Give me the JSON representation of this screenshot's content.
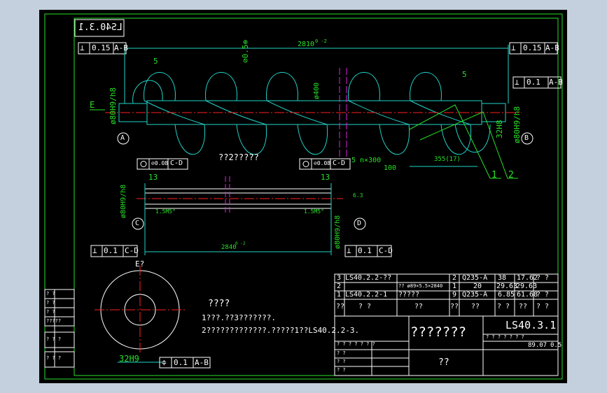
{
  "colors": {
    "background": "#000000",
    "outer_frame": "#c5d0de",
    "green": "#28e128",
    "white": "#ffffff",
    "cyan": "#22d3c9",
    "red": "#ff2020",
    "magenta": "#e020e0",
    "yellow": "#f0f040"
  },
  "drawing": {
    "mirrored_code": "LS40.3.1",
    "fcf_top_left": {
      "symbol": "⊥",
      "tol": "0.15",
      "datum": "A-B"
    },
    "fcf_top_right": {
      "symbol": "⊥",
      "tol": "0.15",
      "datum": "A-B"
    },
    "fcf_right_1": {
      "symbol": "⊥",
      "tol": "0.1",
      "datum": "A-B"
    },
    "fcf_right_2": {
      "symbol": "⊥",
      "tol": "0.1",
      "datum": "A-B"
    },
    "dim_total": "2810",
    "dim_total_tol": "0 -2",
    "dim_pitch_note": "⊘0.5⊕",
    "dim_dia_400": "ø400",
    "dim_fit_left": "ø80H9/h8",
    "dim_fit_right": "ø80H9/h8",
    "dim_32h8": "32H8",
    "weld_5": "5",
    "weld_note": "5 n×300",
    "weld_angle": "100",
    "dim_355": "355(17)",
    "leader_1": "1",
    "leader_2": "2",
    "datum_A": "A",
    "datum_B": "B",
    "datum_C": "C",
    "datum_D": "D",
    "section_E": "E",
    "view_title_shaft": "??2?????",
    "fcf_c1": {
      "tol": "⊘0.08",
      "datum": "C-D"
    },
    "fcf_c2": {
      "tol": "⊘0.08",
      "datum": "C-D"
    },
    "dim_13_left": "13",
    "dim_13_right": "13",
    "chamfer_left": "1.5M5°",
    "chamfer_right": "1.5M5°",
    "roughness": "6.3",
    "dim_fit_c": "ø80H9/h8",
    "dim_fit_d": "ø80H9/h8",
    "dim_shaft_len": "2840",
    "dim_shaft_tol": "0 -2",
    "fcf_bottom_left": {
      "symbol": "⊥",
      "tol": "0.1",
      "datum": "C-D"
    },
    "fcf_bottom_right": {
      "symbol": "⊥",
      "tol": "0.1",
      "datum": "C-D"
    },
    "section_view_label": "E?",
    "dim_32h9": "32H9",
    "fcf_section": {
      "symbol": "≑",
      "tol": "0.1",
      "datum": "A-B"
    },
    "notes_title": "????",
    "note_1": "1???.??3???????.",
    "note_2": "2?????????????.?????1??LS40.2.2-3.",
    "side_labels": [
      "? ?",
      "? ?",
      "? ?",
      "?????",
      "? ? ?",
      "? ? ?"
    ]
  },
  "title_block": {
    "rows": [
      {
        "no": "3",
        "code": "LS40.2.2-??",
        "name": "",
        "qty": "2",
        "material": "Q235-A",
        "unit_w": "38",
        "total_w": "17.62",
        "note": "? ?"
      },
      {
        "no": "2",
        "code": "",
        "name": "?? ø89×5.5×2840",
        "qty": "1",
        "material": "20",
        "unit_w": "29.63",
        "total_w": "29.63",
        "note": ""
      },
      {
        "no": "1",
        "code": "LS40.2.2-1",
        "name": "?????",
        "qty": "9",
        "material": "Q235-A",
        "unit_w": "6.85",
        "total_w": "61.68",
        "note": "? ?"
      }
    ],
    "header": [
      "??",
      "? ?",
      "??",
      "??",
      "??",
      "? ?",
      "??",
      "? ?"
    ],
    "drawing_name": "???????",
    "drawing_code": "LS40.3.1",
    "scale_row": "? ? ? ? ? ? ?",
    "weight": "89.07",
    "scale": "0.5",
    "company": "??",
    "sign_rows": [
      "? ? ? ? ? ? ?",
      "? ?",
      "? ?",
      "? ?"
    ]
  }
}
